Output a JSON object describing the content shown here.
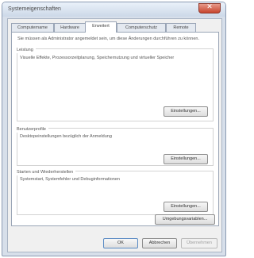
{
  "window": {
    "title": "Systemeigenschaften",
    "close_glyph": "✕"
  },
  "tabs": [
    {
      "label": "Computername"
    },
    {
      "label": "Hardware"
    },
    {
      "label": "Erweitert"
    },
    {
      "label": "Computerschutz"
    },
    {
      "label": "Remote"
    }
  ],
  "active_tab": "Erweitert",
  "panel": {
    "intro": "Sie müssen als Administrator angemeldet sein, um diese Änderungen durchführen zu können.",
    "sections": [
      {
        "title": "Leistung",
        "description": "Visuelle Effekte, Prozessorzeitplanung, Speichernutzung und virtueller Speicher",
        "button": "Einstellungen..."
      },
      {
        "title": "Benutzerprofile",
        "description": "Desktopeinstellungen bezüglich der Anmeldung",
        "button": "Einstellungen..."
      },
      {
        "title": "Starten und Wiederherstellen",
        "description": "Systemstart, Systemfehler und Debuginformationen",
        "button": "Einstellungen..."
      }
    ],
    "env_button": "Umgebungsvariablen..."
  },
  "footer": {
    "ok": "OK",
    "cancel": "Abbrechen",
    "apply": "Übernehmen"
  },
  "colors": {
    "close_button": "#c7442d",
    "frame": "#d7dfea"
  }
}
